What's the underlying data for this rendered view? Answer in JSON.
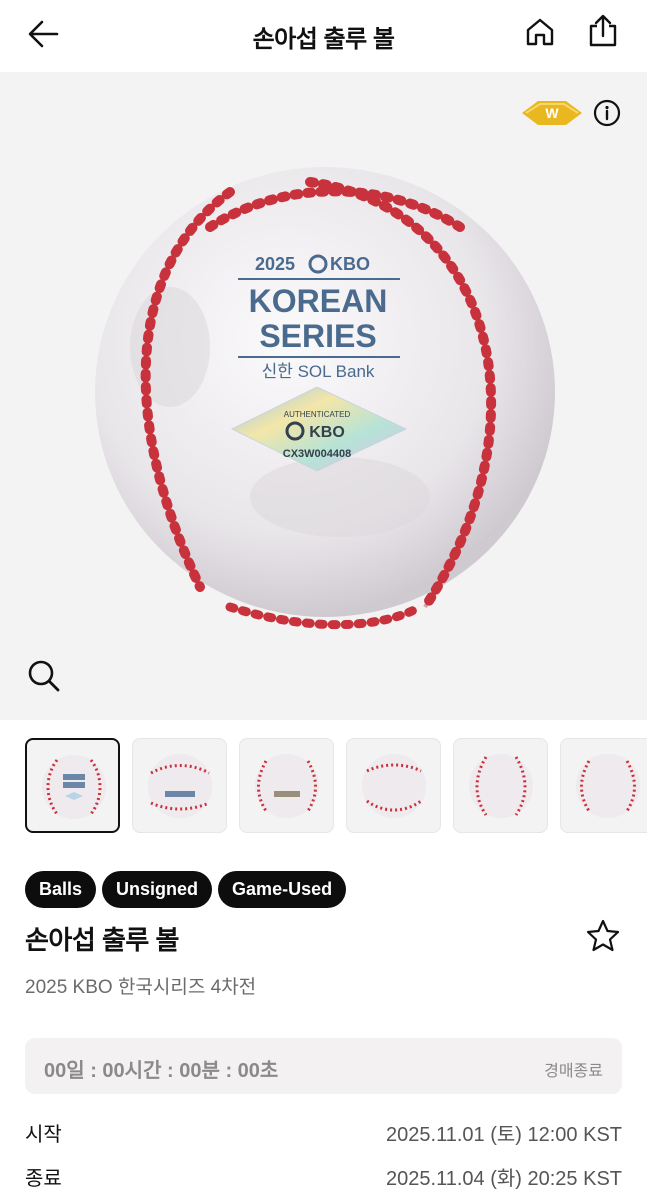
{
  "header": {
    "title": "손아섭 출루 볼"
  },
  "hero": {
    "badge_letter": "W",
    "ball_print": {
      "year": "2025",
      "league": "KBO",
      "line1": "KOREAN",
      "line2": "SERIES",
      "sponsor": "신한 SOL Bank",
      "hologram_header": "AUTHENTICATED",
      "hologram_brand": "KBO",
      "serial": "CX3W004408"
    }
  },
  "thumbnails": [
    {
      "name": "thumbnail-1",
      "active": true
    },
    {
      "name": "thumbnail-2",
      "active": false
    },
    {
      "name": "thumbnail-3",
      "active": false
    },
    {
      "name": "thumbnail-4",
      "active": false
    },
    {
      "name": "thumbnail-5",
      "active": false
    },
    {
      "name": "thumbnail-6",
      "active": false
    }
  ],
  "tags": [
    "Balls",
    "Unsigned",
    "Game-Used"
  ],
  "item": {
    "title": "손아섭 출루 볼",
    "subtitle": "2025 KBO 한국시리즈 4차전"
  },
  "auction": {
    "countdown": "00일 : 00시간 : 00분 : 00초",
    "status": "경매종료",
    "start_label": "시작",
    "start_value": "2025.11.01 (토) 12:00 KST",
    "end_label": "종료",
    "end_value": "2025.11.04 (화) 20:25 KST"
  },
  "colors": {
    "badge_gold": "#e9b820",
    "stitch_red": "#c8323c",
    "tag_bg": "#0d0d0d",
    "timer_bg": "#f4f1f3"
  },
  "icons": [
    "back-arrow-icon",
    "home-icon",
    "share-icon",
    "info-icon",
    "zoom-icon",
    "star-icon"
  ]
}
